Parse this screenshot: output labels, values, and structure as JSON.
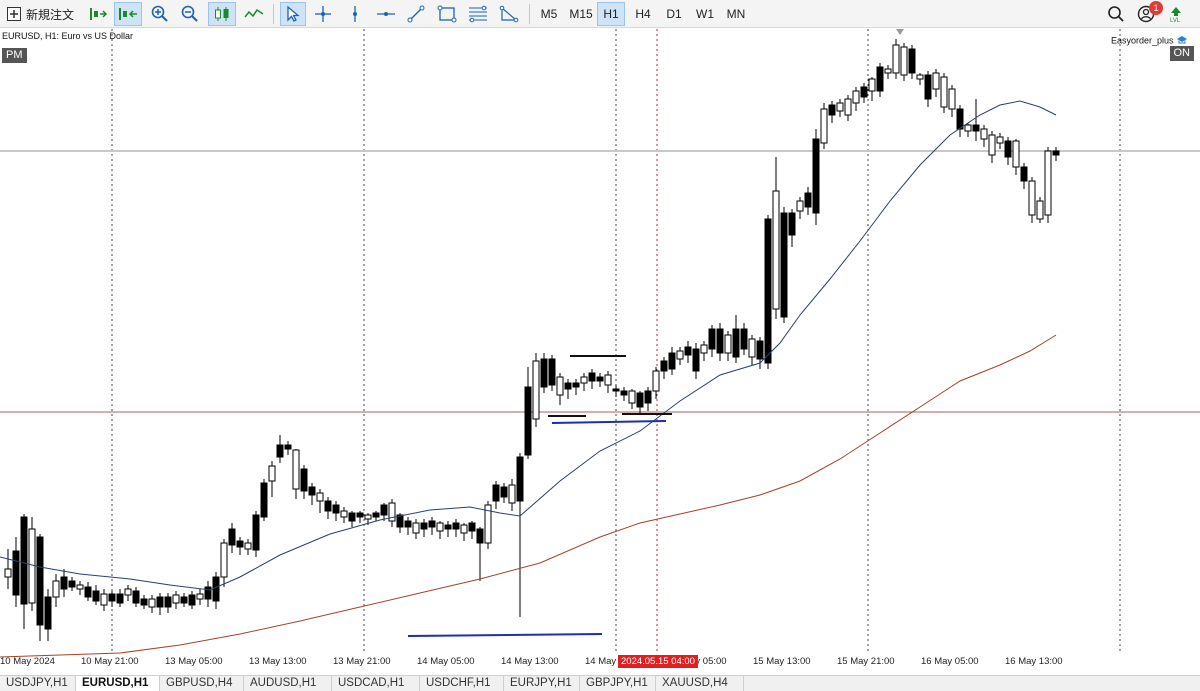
{
  "toolbar": {
    "new_order_label": "新規注文",
    "timeframes": [
      "M5",
      "M15",
      "H1",
      "H4",
      "D1",
      "W1",
      "MN"
    ],
    "active_timeframe": "H1",
    "notification_count": "1",
    "icons": [
      "new-order-icon",
      "algo-trading-icon",
      "one-click-icon",
      "zoom-in-icon",
      "zoom-out-icon",
      "candles-icon",
      "line-chart-icon",
      "cursor-icon",
      "crosshair-icon",
      "vertical-line-icon",
      "horizontal-line-icon",
      "trendline-icon",
      "rectangle-icon",
      "fibonacci-icon",
      "shapes-icon",
      "search-icon",
      "account-icon",
      "signal-icon"
    ]
  },
  "chart": {
    "title": "EURUSD, H1:  Euro vs US Dollar",
    "session_badge": "PM",
    "ea_label": "Easyorder_plus",
    "ea_status": "ON",
    "cursor_time_label": "2024.05.15 04:00",
    "x_labels": [
      "10 May 2024",
      "10 May 21:00",
      "13 May 05:00",
      "13 May 13:00",
      "13 May 21:00",
      "14 May 05:00",
      "14 May 13:00",
      "14 May",
      "15 May 05:00",
      "15 May 13:00",
      "15 May 21:00",
      "16 May 05:00",
      "16 May 13:00"
    ]
  },
  "tabs": [
    {
      "label": "USDJPY,H1",
      "active": false
    },
    {
      "label": "EURUSD,H1",
      "active": true
    },
    {
      "label": "GBPUSD,H4",
      "active": false
    },
    {
      "label": "AUDUSD,H1",
      "active": false
    },
    {
      "label": "USDCAD,H1",
      "active": false
    },
    {
      "label": "USDCHF,H1",
      "active": false
    },
    {
      "label": "EURJPY,H1",
      "active": false
    },
    {
      "label": "GBPJPY,H1",
      "active": false
    },
    {
      "label": "XAUUSD,H4",
      "active": false
    }
  ],
  "colors": {
    "bull": "#ffffff",
    "bear": "#000000",
    "ma_short": "#2a3f6e",
    "ma_long": "#a0442b",
    "user_line": "#1f2db0",
    "cursor_red": "#e02020"
  }
}
